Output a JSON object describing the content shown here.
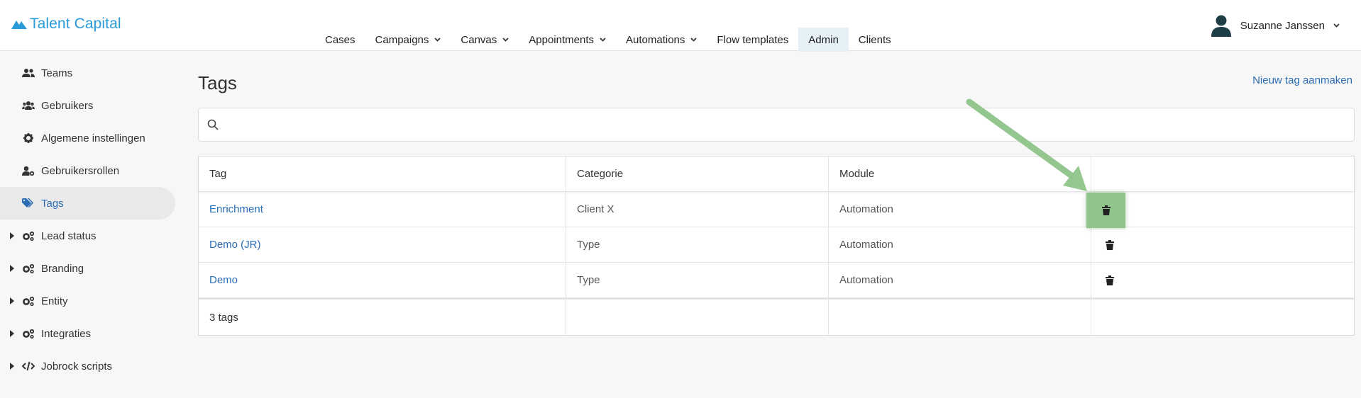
{
  "brand": {
    "name": "Talent Capital",
    "color": "#2a9bd8"
  },
  "nav": [
    {
      "label": "Cases",
      "dropdown": false,
      "active": false
    },
    {
      "label": "Campaigns",
      "dropdown": true,
      "active": false
    },
    {
      "label": "Canvas",
      "dropdown": true,
      "active": false
    },
    {
      "label": "Appointments",
      "dropdown": true,
      "active": false
    },
    {
      "label": "Automations",
      "dropdown": true,
      "active": false
    },
    {
      "label": "Flow templates",
      "dropdown": false,
      "active": false
    },
    {
      "label": "Admin",
      "dropdown": false,
      "active": true
    },
    {
      "label": "Clients",
      "dropdown": false,
      "active": false
    }
  ],
  "user": {
    "name": "Suzanne Janssen",
    "icon": "user-avatar-icon"
  },
  "sidebar": {
    "items": [
      {
        "label": "Teams",
        "icon": "users-icon"
      },
      {
        "label": "Gebruikers",
        "icon": "group-icon"
      },
      {
        "label": "Algemene instellingen",
        "icon": "gear-icon"
      },
      {
        "label": "Gebruikersrollen",
        "icon": "user-cog-icon"
      },
      {
        "label": "Tags",
        "icon": "tags-icon",
        "active": true
      },
      {
        "label": "Lead status",
        "icon": "gears-icon",
        "expandable": true
      },
      {
        "label": "Branding",
        "icon": "gears-icon",
        "expandable": true
      },
      {
        "label": "Entity",
        "icon": "gears-icon",
        "expandable": true
      },
      {
        "label": "Integraties",
        "icon": "gears-icon",
        "expandable": true
      },
      {
        "label": "Jobrock scripts",
        "icon": "code-icon",
        "expandable": true
      }
    ]
  },
  "main": {
    "title": "Tags",
    "new_tag_label": "Nieuw tag aanmaken",
    "search": {
      "placeholder": "",
      "value": ""
    },
    "table": {
      "headers": [
        "Tag",
        "Categorie",
        "Module",
        ""
      ],
      "rows": [
        {
          "tag": "Enrichment",
          "categorie": "Client X",
          "module": "Automation",
          "highlighted": true
        },
        {
          "tag": "Demo (JR)",
          "categorie": "Type",
          "module": "Automation"
        },
        {
          "tag": "Demo",
          "categorie": "Type",
          "module": "Automation"
        }
      ],
      "footer": "3 tags"
    }
  },
  "colors": {
    "link": "#2a6db5",
    "highlight": "#8fc48b",
    "arrow": "#8fc48b",
    "active_nav_bg": "#e6f1f7"
  }
}
